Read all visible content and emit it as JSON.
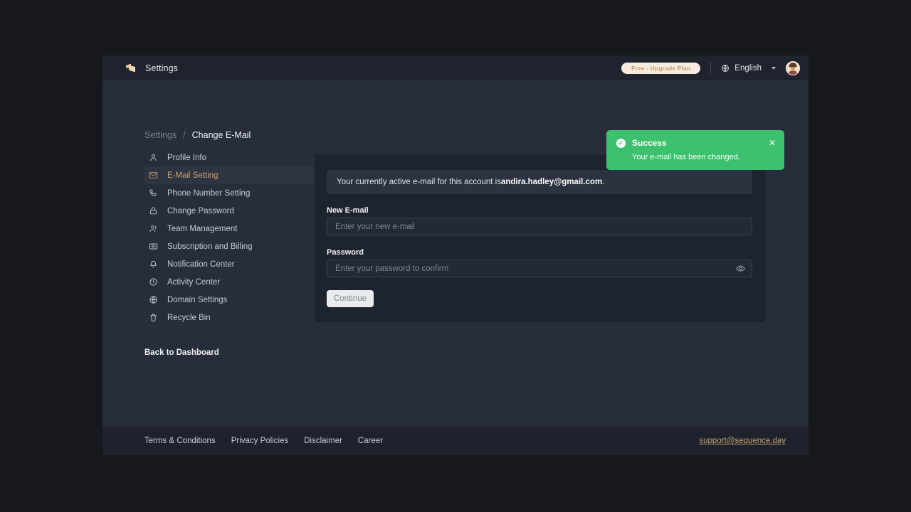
{
  "app": {
    "title": "Settings",
    "logo_icon": "logo-mark-icon"
  },
  "header": {
    "upgrade_badge": "Free - Upgrade Plan",
    "globe_icon": "globe-icon",
    "language": "English",
    "caret_icon": "chevron-down-icon",
    "avatar_icon": "avatar"
  },
  "breadcrumb": {
    "root": "Settings",
    "separator": "/",
    "current": "Change E-Mail"
  },
  "sidebar": {
    "items": [
      {
        "label": "Profile Info",
        "icon": "user-icon",
        "active": false
      },
      {
        "label": "E-Mail Setting",
        "icon": "mail-icon",
        "active": true
      },
      {
        "label": "Phone Number Setting",
        "icon": "phone-icon",
        "active": false
      },
      {
        "label": "Change Password",
        "icon": "lock-icon",
        "active": false
      },
      {
        "label": "Team Management",
        "icon": "users-icon",
        "active": false
      },
      {
        "label": "Subscription and Billing",
        "icon": "card-icon",
        "active": false
      },
      {
        "label": "Notification Center",
        "icon": "bell-icon",
        "active": false
      },
      {
        "label": "Activity Center",
        "icon": "activity-icon",
        "active": false
      },
      {
        "label": "Domain Settings",
        "icon": "globe-icon",
        "active": false
      },
      {
        "label": "Recycle Bin",
        "icon": "trash-icon",
        "active": false
      }
    ],
    "back_link": "Back to Dashboard"
  },
  "main": {
    "info_prefix": "Your currently active e-mail for this account is ",
    "info_email": "andira.hadley@gmail.com",
    "info_suffix": ".",
    "new_email_label": "New E-mail",
    "new_email_value": "",
    "new_email_placeholder": "Enter your new e-mail",
    "password_label": "Password",
    "password_value": "",
    "password_placeholder": "Enter your password to confirm",
    "eye_icon": "eye-icon",
    "continue_label": "Continue"
  },
  "toast": {
    "check_icon": "check-icon",
    "title": "Success",
    "message": "Your e-mail has been changed.",
    "close_icon": "close-icon",
    "color": "#3ec16f"
  },
  "footer": {
    "links": [
      "Terms & Conditions",
      "Privacy Policies",
      "Disclaimer",
      "Career"
    ],
    "support_email": "support@sequence.day"
  },
  "colors": {
    "page_bg": "#272d3a",
    "card_bg": "#1e242f",
    "header_bg": "#1e232d",
    "accent": "#c9a070",
    "success": "#3ec16f"
  }
}
